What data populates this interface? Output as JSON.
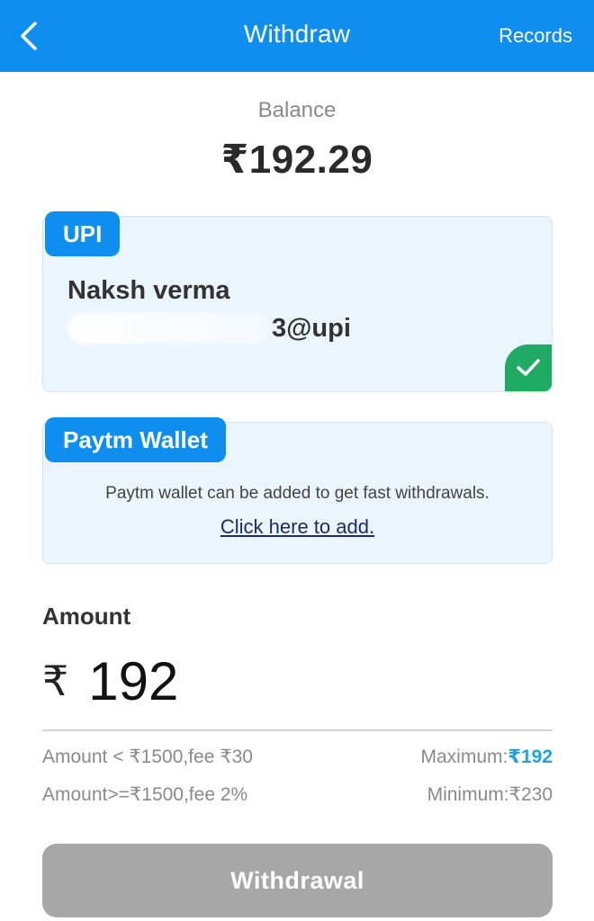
{
  "header": {
    "title": "Withdraw",
    "records_label": "Records",
    "back_icon": "chevron-left-icon"
  },
  "balance": {
    "label": "Balance",
    "value": "₹192.29"
  },
  "upi": {
    "tag": "UPI",
    "name": "Naksh verma",
    "id_visible": "3@upi",
    "selected": true,
    "check_icon": "check-icon"
  },
  "paytm": {
    "tag": "Paytm Wallet",
    "description": "Paytm wallet can be added to get fast withdrawals.",
    "link": "Click here to add."
  },
  "amount": {
    "label": "Amount",
    "currency": "₹",
    "value": "192"
  },
  "fees": {
    "rule1": "Amount < ₹1500,fee ₹30",
    "rule2": "Amount>=₹1500,fee 2%"
  },
  "limits": {
    "max_label": "Maximum:",
    "max_value": "₹192",
    "min_label": "Minimum:",
    "min_value": "₹230"
  },
  "withdraw_button": "Withdrawal",
  "colors": {
    "primary": "#0e8ff0",
    "card_bg": "#eaf5fd",
    "success": "#1fab63",
    "disabled_button": "#a7a7a7",
    "max_value": "#1ca3e6"
  }
}
